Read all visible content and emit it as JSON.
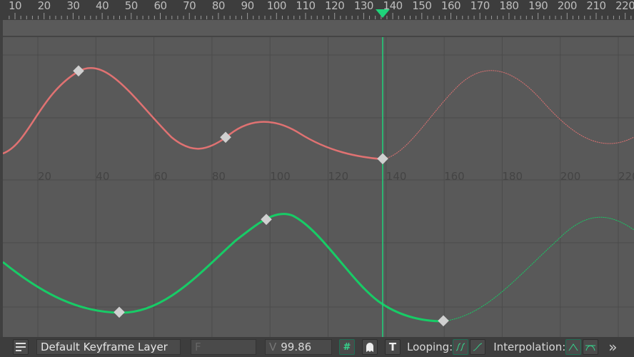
{
  "ruler": {
    "labels": [
      "10",
      "20",
      "30",
      "40",
      "50",
      "60",
      "70",
      "80",
      "90",
      "100",
      "110",
      "120",
      "130",
      "140",
      "150",
      "160",
      "170",
      "180",
      "190",
      "200",
      "210",
      "220"
    ],
    "playhead_frame": 136
  },
  "graph": {
    "mid_labels": [
      "20",
      "40",
      "60",
      "80",
      "100",
      "120",
      "140",
      "160",
      "180",
      "200",
      "220"
    ]
  },
  "curves": {
    "colors": {
      "red": "#e07272",
      "green": "#17cc66",
      "keyframe": "#d0d0d0",
      "playhead": "#1fd37a"
    }
  },
  "toolbar": {
    "layer_name": "Default Keyframe Layer",
    "frame_placeholder": "F",
    "value_prefix": "V",
    "value": "99.86",
    "looping_label": "Looping:",
    "interpolation_label": "Interpolation:",
    "more": "»"
  }
}
